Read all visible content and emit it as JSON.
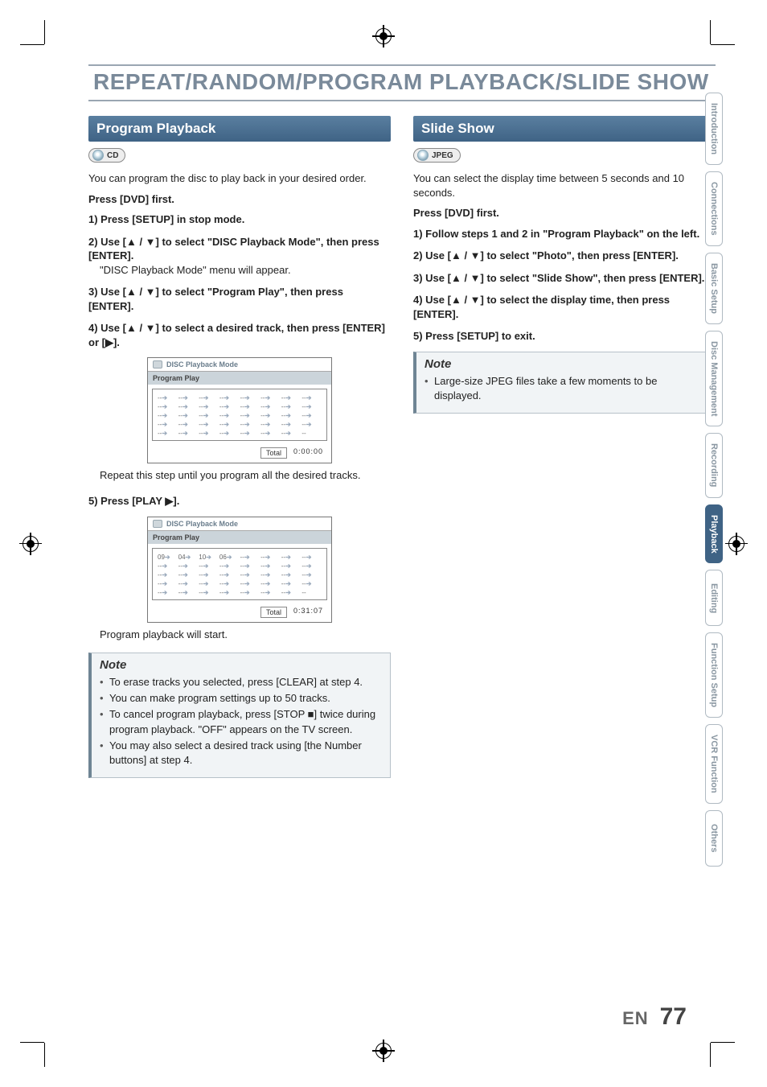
{
  "page": {
    "title": "REPEAT/RANDOM/PROGRAM PLAYBACK/SLIDE SHOW",
    "lang": "EN",
    "number": "77"
  },
  "left": {
    "section_title": "Program Playback",
    "badge": "CD",
    "intro": "You can program the disc to play back in your desired order.",
    "press_first": "Press [DVD] first.",
    "step1": "1) Press [SETUP] in stop mode.",
    "step2_head": "2) Use [▲ / ▼] to select \"DISC Playback Mode\", then press [ENTER].",
    "step2_body": "\"DISC Playback Mode\" menu will appear.",
    "step3": "3) Use [▲ / ▼] to select \"Program Play\", then press [ENTER].",
    "step4": "4) Use [▲ / ▼] to select a desired track, then press [ENTER] or [▶].",
    "screen1": {
      "title": "DISC Playback Mode",
      "subtitle": "Program Play",
      "total_label": "Total",
      "total_value": "0:00:00"
    },
    "caption1": "Repeat this step until you program all the desired tracks.",
    "step5": "5) Press [PLAY ▶].",
    "screen2": {
      "title": "DISC Playback Mode",
      "subtitle": "Program Play",
      "row1": [
        "09",
        "04",
        "10",
        "06"
      ],
      "total_label": "Total",
      "total_value": "0:31:07"
    },
    "caption2": "Program playback will start.",
    "note_title": "Note",
    "notes": [
      "To erase tracks you selected, press [CLEAR] at step 4.",
      "You can make program settings up to 50 tracks.",
      "To cancel program playback, press [STOP ■] twice during program playback. \"OFF\" appears on the TV screen.",
      "You may also select a desired track using [the Number buttons] at step 4."
    ]
  },
  "right": {
    "section_title": "Slide Show",
    "badge": "JPEG",
    "intro": "You can select the display time between 5 seconds and 10 seconds.",
    "press_first": "Press [DVD] first.",
    "step1": "1) Follow steps 1 and 2 in \"Program Playback\" on the left.",
    "step2": "2) Use [▲ / ▼] to select \"Photo\", then press [ENTER].",
    "step3": "3) Use [▲ / ▼] to select \"Slide Show\", then press [ENTER].",
    "step4": "4) Use [▲ / ▼] to select the display time, then press [ENTER].",
    "step5": "5) Press [SETUP] to exit.",
    "note_title": "Note",
    "notes": [
      "Large-size JPEG files take a few moments to be displayed."
    ]
  },
  "tabs": [
    {
      "label": "Introduction",
      "active": false
    },
    {
      "label": "Connections",
      "active": false
    },
    {
      "label": "Basic Setup",
      "active": false
    },
    {
      "label": "Disc\nManagement",
      "active": false
    },
    {
      "label": "Recording",
      "active": false
    },
    {
      "label": "Playback",
      "active": true
    },
    {
      "label": "Editing",
      "active": false
    },
    {
      "label": "Function Setup",
      "active": false
    },
    {
      "label": "VCR Function",
      "active": false
    },
    {
      "label": "Others",
      "active": false
    }
  ]
}
